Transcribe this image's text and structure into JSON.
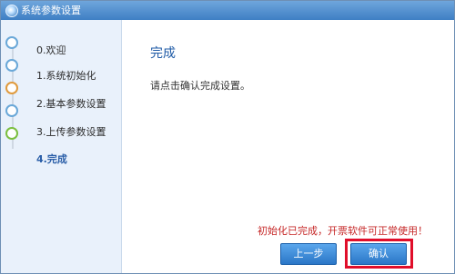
{
  "window": {
    "title": "系统参数设置"
  },
  "sidebar": {
    "steps": [
      {
        "label": "0.欢迎",
        "icon": "welcome-icon"
      },
      {
        "label": "1.系统初始化",
        "icon": "settings-gear-icon"
      },
      {
        "label": "2.基本参数设置",
        "icon": "user-icon"
      },
      {
        "label": "3.上传参数设置",
        "icon": "upload-icon"
      },
      {
        "label": "4.完成",
        "icon": "check-icon",
        "active": true
      }
    ]
  },
  "main": {
    "title": "完成",
    "instruction": "请点击确认完成设置。",
    "notice": "初始化已完成，开票软件可正常使用！"
  },
  "buttons": {
    "prev": "上一步",
    "confirm": "确认"
  },
  "colors": {
    "title_bar": "#3f7fc4",
    "sidebar_bg": "#e9f1fb",
    "accent": "#1e5aa6",
    "notice": "#c62828",
    "highlight_border": "#e00e2a",
    "button": "#2b77c7"
  }
}
